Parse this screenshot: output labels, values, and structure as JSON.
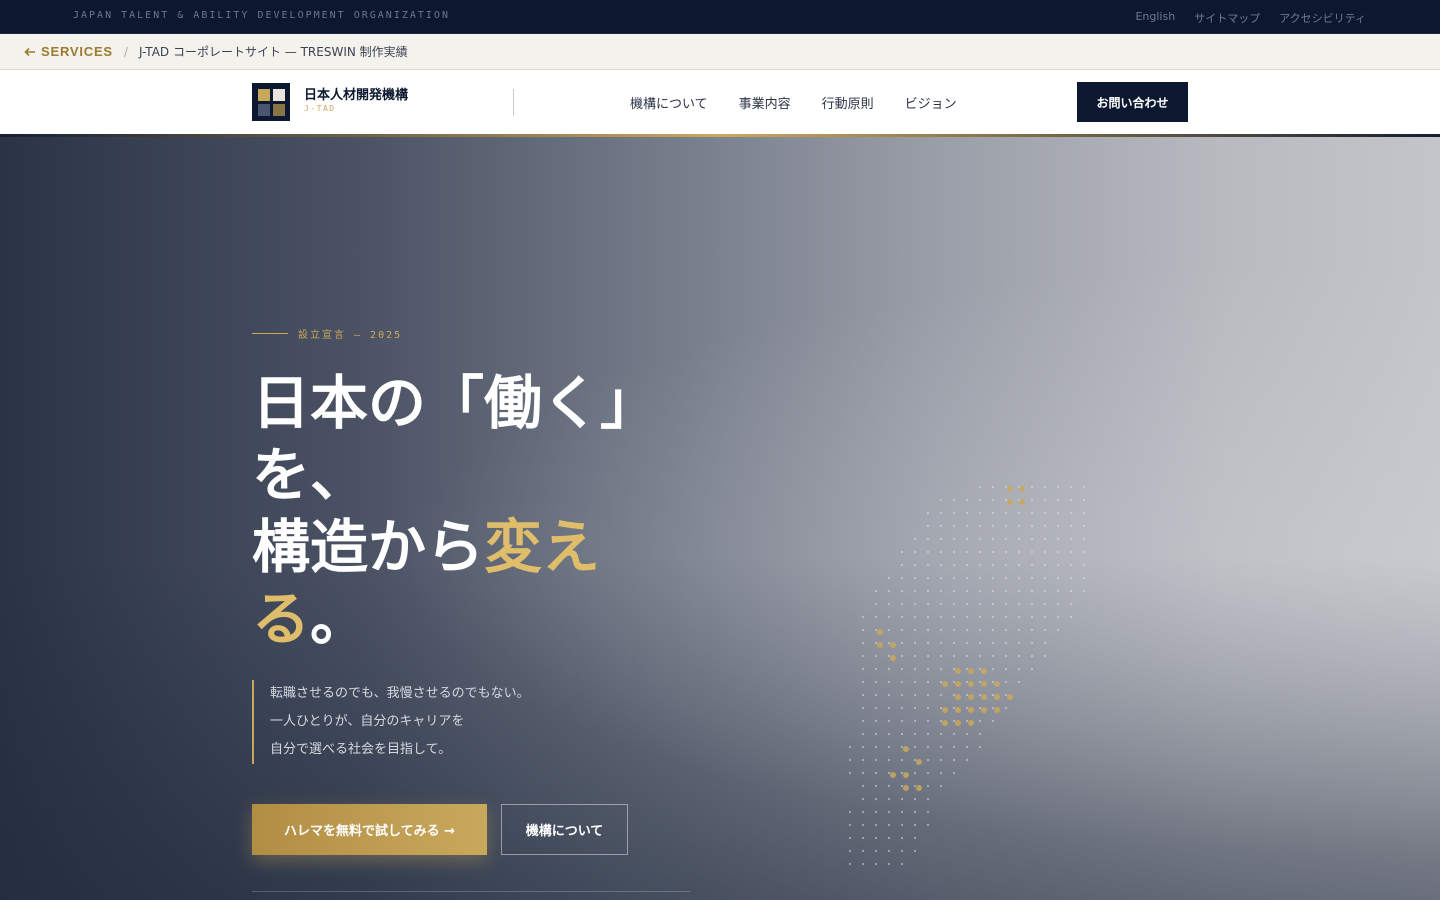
{
  "topbar": {
    "org_name": "JAPAN TALENT & ABILITY DEVELOPMENT ORGANIZATION",
    "links": [
      "English",
      "サイトマップ",
      "アクセシビリティ"
    ]
  },
  "breadcrumb": {
    "back_label": "SERVICES",
    "back_icon": "arrow-left-icon",
    "separator": "/",
    "current": "J-TAD コーポレートサイト — TRESWIN 制作実績"
  },
  "header": {
    "logo_jp": "日本人材開発機構",
    "logo_en": "J-TAD",
    "nav": [
      "機構について",
      "事業内容",
      "行動原則",
      "ビジョン"
    ],
    "cta_label": "お問い合わせ"
  },
  "hero": {
    "eyebrow": "設立宣言 — 2025",
    "headline_line1": "日本の「働く」",
    "headline_line2": "を、",
    "headline_line3_plain": "構造から",
    "headline_line3_gold": "変え",
    "headline_line4_gold": "る",
    "headline_line4_plain": "。",
    "lead": [
      "転職させるのでも、我慢させるのでもない。",
      "一人ひとりが、自分のキャリアを",
      "自分で選べる社会を目指して。"
    ],
    "primary_button": "ハレマを無料で試してみる →",
    "secondary_button": "機構について"
  },
  "colors": {
    "navy": "#0c1830",
    "gold": "#c9a85c",
    "gold_text": "#e0bd6a"
  }
}
